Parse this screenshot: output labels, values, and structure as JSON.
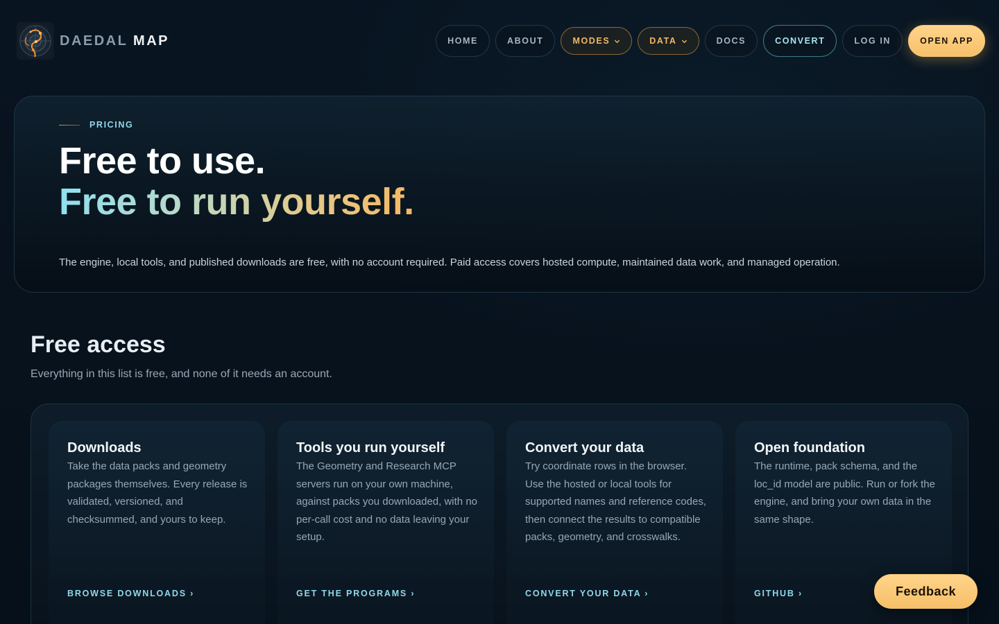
{
  "brand": {
    "name_part1": "DAEDAL",
    "name_part2": "MAP",
    "logo_icon": "compass-map-logo"
  },
  "nav": {
    "items": [
      {
        "label": "HOME"
      },
      {
        "label": "ABOUT"
      },
      {
        "label": "MODES",
        "dropdown": true
      },
      {
        "label": "DATA",
        "dropdown": true
      },
      {
        "label": "DOCS"
      },
      {
        "label": "CONVERT"
      },
      {
        "label": "LOG IN"
      },
      {
        "label": "OPEN APP"
      }
    ]
  },
  "hero": {
    "eyebrow": "PRICING",
    "title_line1": "Free to use.",
    "title_line2": "Free to run yourself.",
    "description": "The engine, local tools, and published downloads are free, with no account required. Paid access covers hosted compute, maintained data work, and managed operation."
  },
  "free_access": {
    "title": "Free access",
    "subtitle": "Everything in this list is free, and none of it needs an account.",
    "cards": [
      {
        "title": "Downloads",
        "body": "Take the data packs and geometry packages themselves. Every release is validated, versioned, and checksummed, and yours to keep.",
        "link": "BROWSE DOWNLOADS ›"
      },
      {
        "title": "Tools you run yourself",
        "body": "The Geometry and Research MCP servers run on your own machine, against packs you downloaded, with no per-call cost and no data leaving your setup.",
        "link": "GET THE PROGRAMS ›"
      },
      {
        "title": "Convert your data",
        "body": "Try coordinate rows in the browser. Use the hosted or local tools for supported names and reference codes, then connect the results to compatible packs, geometry, and crosswalks.",
        "link": "CONVERT YOUR DATA ›"
      },
      {
        "title": "Open foundation",
        "body": "The runtime, pack schema, and the loc_id model are public. Run or fork the engine, and bring your own data in the same shape.",
        "link": "GITHUB ›"
      }
    ]
  },
  "feedback": {
    "label": "Feedback"
  },
  "colors": {
    "background": "#07111a",
    "accent_cyan": "#8fd8ea",
    "accent_gold": "#f6c06a"
  }
}
